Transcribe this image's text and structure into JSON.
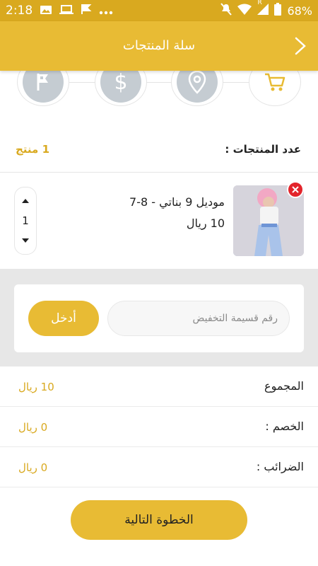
{
  "status_bar": {
    "time": "2:18",
    "battery": "68%",
    "left_icons": [
      "photo-icon",
      "laptop-icon",
      "flag-icon",
      "more-dots-icon"
    ],
    "right_icons": [
      "mute-icon",
      "wifi-icon",
      "signal-icon",
      "battery-icon"
    ],
    "roaming": "R"
  },
  "app_bar": {
    "title": "سلة المنتجات",
    "back_icon": "chevron-right-icon"
  },
  "steps": [
    {
      "icon": "cart-icon",
      "state": "active"
    },
    {
      "icon": "location-pin-icon",
      "state": "inactive"
    },
    {
      "icon": "dollar-icon",
      "state": "inactive"
    },
    {
      "icon": "flag-finish-icon",
      "state": "inactive"
    }
  ],
  "summary": {
    "count_label": "عدد المنتجات :",
    "count_value": "1 منتج"
  },
  "product": {
    "name": "موديل 9 بناتي - 8-7",
    "price": "10 ريال",
    "quantity": "1"
  },
  "coupon": {
    "placeholder": "رقم قسيمة التخفيض",
    "value": "",
    "apply_label": "أدخل"
  },
  "totals": {
    "subtotal_label": "المجموع",
    "subtotal_value": "10 ريال",
    "discount_label": "الخصم :",
    "discount_value": "0 ريال",
    "tax_label": "الضرائب :",
    "tax_value": "0 ريال"
  },
  "next_button": {
    "label": "الخطوة التالية"
  },
  "colors": {
    "accent": "#e8bb34",
    "status_bar": "#d9a91f",
    "accent_text": "#d9a91f",
    "remove": "#e3242b",
    "step_inactive": "#c5ccd2",
    "section_bg": "#e7e7e7"
  }
}
